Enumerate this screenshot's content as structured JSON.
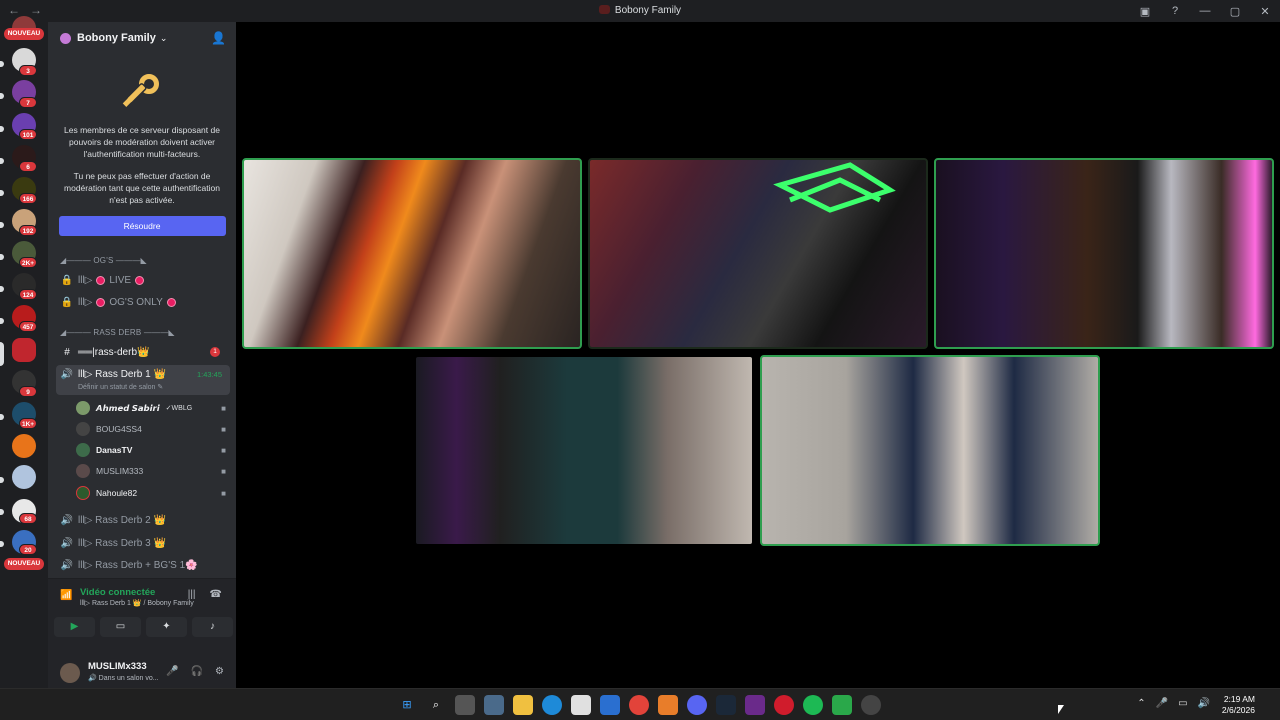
{
  "window": {
    "title": "Bobony Family",
    "back_glyph": "←",
    "forward_glyph": "→",
    "controls": [
      "▣",
      "?",
      "—",
      "▢",
      "✕"
    ]
  },
  "servers": {
    "nouveau_label": "NOUVEAU",
    "badges": [
      "3",
      "7",
      "101",
      "6",
      "166",
      "192",
      "2K+",
      "124",
      "457",
      "9",
      "1K+",
      "68",
      "20"
    ]
  },
  "server": {
    "name": "Bobony Family",
    "invite_icon": "add-person-icon"
  },
  "mfa": {
    "text1": "Les membres de ce serveur disposant de pouvoirs de modération doivent activer l'authentification multi-facteurs.",
    "text2": "Tu ne peux pas effectuer d'action de modération tant que cette authentification n'est pas activée.",
    "button": "Résoudre"
  },
  "categories": {
    "ogs": "◢——— OG'S ———◣",
    "rass": "◢——— RASS DERB ———◣"
  },
  "channels": {
    "live": "LIVE",
    "ogsonly": "OG'S ONLY",
    "prefix": "lll▷",
    "rassderb_text": "══|rass-derb👑",
    "rassderb_mention": "1",
    "voice1": "lll▷ Rass Derb 1 👑",
    "voice1_time": "1:43:45",
    "voice1_status": "Définir un statut de salon ✎",
    "voice2": "lll▷ Rass Derb 2 👑",
    "voice3": "lll▷ Rass Derb 3 👑",
    "voice4": "lll▷ Rass Derb + BG'S 1🌸"
  },
  "voice_users": [
    {
      "name": "𝘼𝙝𝙢𝙚𝙙 𝙎𝙖𝙗𝙞𝙧𝙞",
      "tag": "✓WBLG",
      "color": "#7c9a6a"
    },
    {
      "name": "BOUG4SS4",
      "tag": "",
      "color": "#444"
    },
    {
      "name": "DanasTV",
      "tag": "",
      "color": "#3d6b4a"
    },
    {
      "name": "MUSLIM333",
      "tag": "",
      "color": "#5a4a4a"
    },
    {
      "name": "Nahoule82",
      "tag": "",
      "color": "#2d5a2d"
    }
  ],
  "voicebar": {
    "status": "Vidéo connectée",
    "channel": "lll▷ Rass Derb 1 👑 / Bobony Family"
  },
  "user": {
    "name": "MUSLIMx333",
    "status": "🔊 Dans un salon vo..."
  },
  "taskbar": {
    "time": "2:19 AM",
    "date": "2/6/2026"
  },
  "colors": {
    "accent": "#5865f2",
    "speaking_border": "#2f9e4f",
    "mention": "#da373c",
    "connected": "#23a55a"
  }
}
